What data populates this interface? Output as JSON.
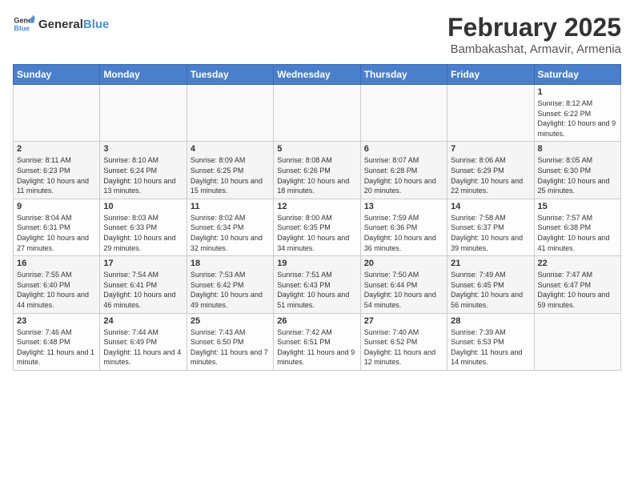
{
  "logo": {
    "text_general": "General",
    "text_blue": "Blue"
  },
  "title": "February 2025",
  "subtitle": "Bambakashat, Armavir, Armenia",
  "days_of_week": [
    "Sunday",
    "Monday",
    "Tuesday",
    "Wednesday",
    "Thursday",
    "Friday",
    "Saturday"
  ],
  "weeks": [
    [
      {
        "day": "",
        "info": ""
      },
      {
        "day": "",
        "info": ""
      },
      {
        "day": "",
        "info": ""
      },
      {
        "day": "",
        "info": ""
      },
      {
        "day": "",
        "info": ""
      },
      {
        "day": "",
        "info": ""
      },
      {
        "day": "1",
        "info": "Sunrise: 8:12 AM\nSunset: 6:22 PM\nDaylight: 10 hours\nand 9 minutes."
      }
    ],
    [
      {
        "day": "2",
        "info": "Sunrise: 8:11 AM\nSunset: 6:23 PM\nDaylight: 10 hours\nand 11 minutes."
      },
      {
        "day": "3",
        "info": "Sunrise: 8:10 AM\nSunset: 6:24 PM\nDaylight: 10 hours\nand 13 minutes."
      },
      {
        "day": "4",
        "info": "Sunrise: 8:09 AM\nSunset: 6:25 PM\nDaylight: 10 hours\nand 15 minutes."
      },
      {
        "day": "5",
        "info": "Sunrise: 8:08 AM\nSunset: 6:26 PM\nDaylight: 10 hours\nand 18 minutes."
      },
      {
        "day": "6",
        "info": "Sunrise: 8:07 AM\nSunset: 6:28 PM\nDaylight: 10 hours\nand 20 minutes."
      },
      {
        "day": "7",
        "info": "Sunrise: 8:06 AM\nSunset: 6:29 PM\nDaylight: 10 hours\nand 22 minutes."
      },
      {
        "day": "8",
        "info": "Sunrise: 8:05 AM\nSunset: 6:30 PM\nDaylight: 10 hours\nand 25 minutes."
      }
    ],
    [
      {
        "day": "9",
        "info": "Sunrise: 8:04 AM\nSunset: 6:31 PM\nDaylight: 10 hours\nand 27 minutes."
      },
      {
        "day": "10",
        "info": "Sunrise: 8:03 AM\nSunset: 6:33 PM\nDaylight: 10 hours\nand 29 minutes."
      },
      {
        "day": "11",
        "info": "Sunrise: 8:02 AM\nSunset: 6:34 PM\nDaylight: 10 hours\nand 32 minutes."
      },
      {
        "day": "12",
        "info": "Sunrise: 8:00 AM\nSunset: 6:35 PM\nDaylight: 10 hours\nand 34 minutes."
      },
      {
        "day": "13",
        "info": "Sunrise: 7:59 AM\nSunset: 6:36 PM\nDaylight: 10 hours\nand 36 minutes."
      },
      {
        "day": "14",
        "info": "Sunrise: 7:58 AM\nSunset: 6:37 PM\nDaylight: 10 hours\nand 39 minutes."
      },
      {
        "day": "15",
        "info": "Sunrise: 7:57 AM\nSunset: 6:38 PM\nDaylight: 10 hours\nand 41 minutes."
      }
    ],
    [
      {
        "day": "16",
        "info": "Sunrise: 7:55 AM\nSunset: 6:40 PM\nDaylight: 10 hours\nand 44 minutes."
      },
      {
        "day": "17",
        "info": "Sunrise: 7:54 AM\nSunset: 6:41 PM\nDaylight: 10 hours\nand 46 minutes."
      },
      {
        "day": "18",
        "info": "Sunrise: 7:53 AM\nSunset: 6:42 PM\nDaylight: 10 hours\nand 49 minutes."
      },
      {
        "day": "19",
        "info": "Sunrise: 7:51 AM\nSunset: 6:43 PM\nDaylight: 10 hours\nand 51 minutes."
      },
      {
        "day": "20",
        "info": "Sunrise: 7:50 AM\nSunset: 6:44 PM\nDaylight: 10 hours\nand 54 minutes."
      },
      {
        "day": "21",
        "info": "Sunrise: 7:49 AM\nSunset: 6:45 PM\nDaylight: 10 hours\nand 56 minutes."
      },
      {
        "day": "22",
        "info": "Sunrise: 7:47 AM\nSunset: 6:47 PM\nDaylight: 10 hours\nand 59 minutes."
      }
    ],
    [
      {
        "day": "23",
        "info": "Sunrise: 7:46 AM\nSunset: 6:48 PM\nDaylight: 11 hours\nand 1 minute."
      },
      {
        "day": "24",
        "info": "Sunrise: 7:44 AM\nSunset: 6:49 PM\nDaylight: 11 hours\nand 4 minutes."
      },
      {
        "day": "25",
        "info": "Sunrise: 7:43 AM\nSunset: 6:50 PM\nDaylight: 11 hours\nand 7 minutes."
      },
      {
        "day": "26",
        "info": "Sunrise: 7:42 AM\nSunset: 6:51 PM\nDaylight: 11 hours\nand 9 minutes."
      },
      {
        "day": "27",
        "info": "Sunrise: 7:40 AM\nSunset: 6:52 PM\nDaylight: 11 hours\nand 12 minutes."
      },
      {
        "day": "28",
        "info": "Sunrise: 7:39 AM\nSunset: 6:53 PM\nDaylight: 11 hours\nand 14 minutes."
      },
      {
        "day": "",
        "info": ""
      }
    ]
  ]
}
